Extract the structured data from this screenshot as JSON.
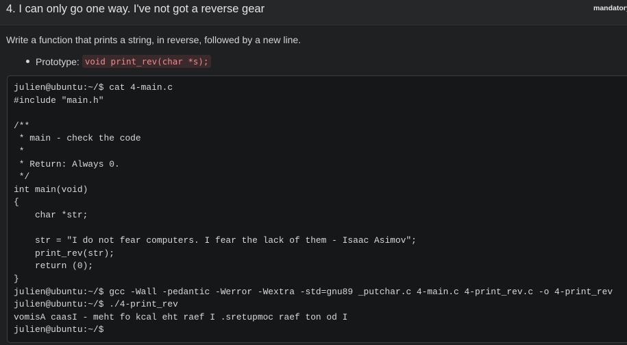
{
  "task": {
    "title": "4. I can only go one way. I've not got a reverse gear",
    "badge": "mandatory",
    "description": "Write a function that prints a string, in reverse, followed by a new line.",
    "prototype_label": "Prototype:",
    "prototype_code": "void print_rev(char *s);"
  },
  "terminal": {
    "content": "julien@ubuntu:~/$ cat 4-main.c\n#include \"main.h\"\n\n/**\n * main - check the code\n *\n * Return: Always 0.\n */\nint main(void)\n{\n    char *str;\n\n    str = \"I do not fear computers. I fear the lack of them - Isaac Asimov\";\n    print_rev(str);\n    return (0);\n}\njulien@ubuntu:~/$ gcc -Wall -pedantic -Werror -Wextra -std=gnu89 _putchar.c 4-main.c 4-print_rev.c -o 4-print_rev\njulien@ubuntu:~/$ ./4-print_rev\nvomisA caasI - meht fo kcal eht raef I .sretupmoc raef ton od I\njulien@ubuntu:~/$"
  }
}
